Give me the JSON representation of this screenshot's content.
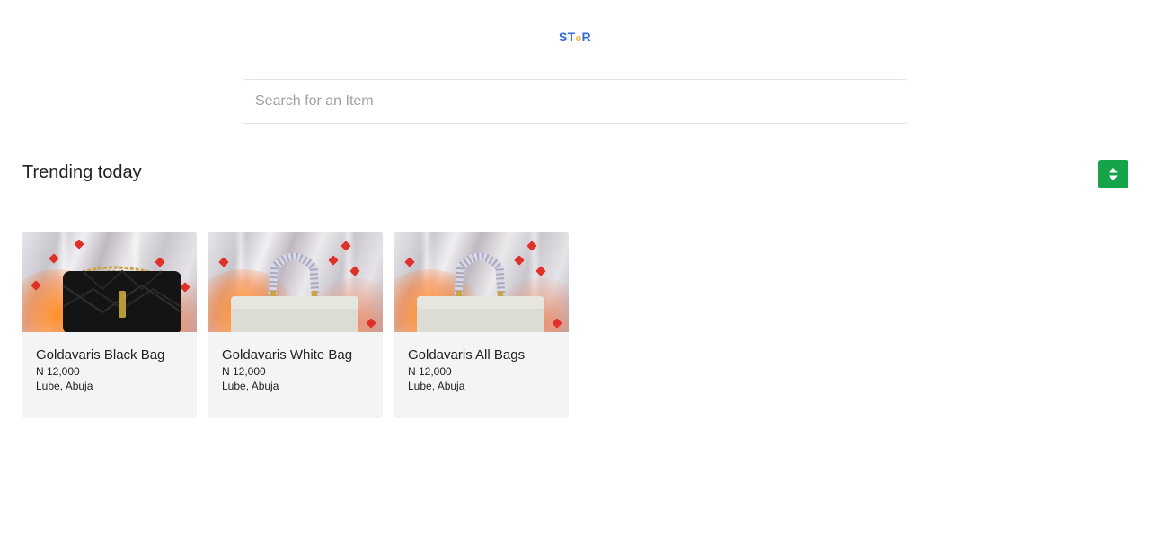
{
  "brand": {
    "logo_letters": [
      "S",
      "T",
      "o",
      "R"
    ],
    "primary_color": "#2f6bd9",
    "accent_color": "#f2b233"
  },
  "search": {
    "placeholder": "Search for an Item",
    "value": ""
  },
  "section": {
    "title": "Trending today",
    "sort_button_icon": "sort-icon",
    "sort_button_color": "#16a34a"
  },
  "products": [
    {
      "name": "Goldavaris Black Bag",
      "price": "N 12,000",
      "location": "Lube, Abuja",
      "image_icon": "black-handbag-image"
    },
    {
      "name": "Goldavaris White Bag",
      "price": "N 12,000",
      "location": "Lube, Abuja",
      "image_icon": "white-handbag-image"
    },
    {
      "name": "Goldavaris All Bags",
      "price": "N 12,000",
      "location": "Lube, Abuja",
      "image_icon": "white-handbag-image"
    }
  ]
}
